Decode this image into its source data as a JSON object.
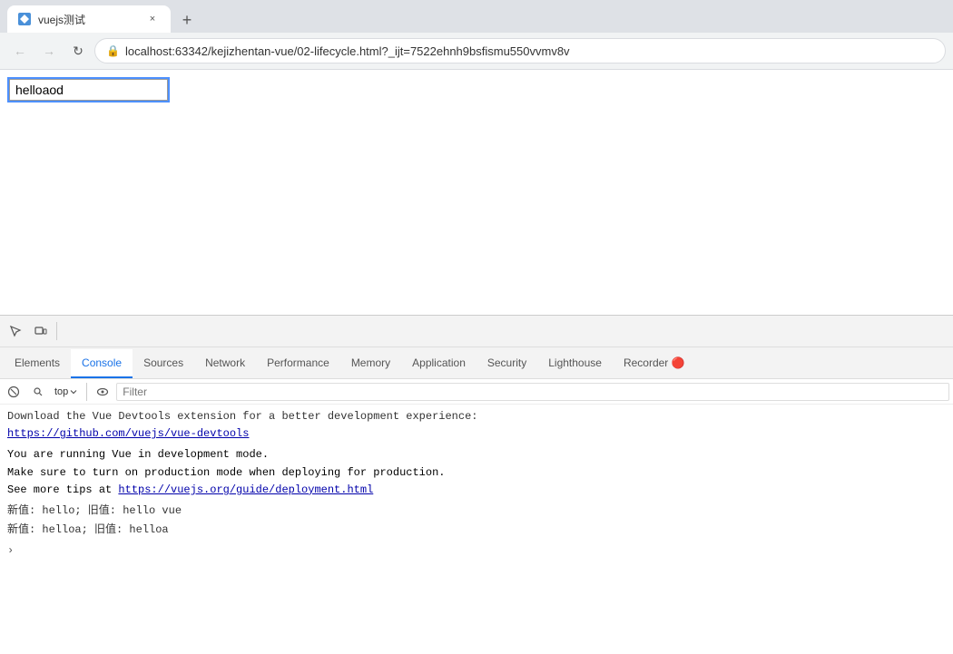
{
  "browser": {
    "tab": {
      "favicon_label": "vue",
      "title": "vuejs测试",
      "close_label": "×"
    },
    "new_tab_label": "+",
    "nav": {
      "back_label": "←",
      "forward_label": "→",
      "reload_label": "↻"
    },
    "address": {
      "lock_icon": "🔒",
      "url": "localhost:63342/kejizhentan-vue/02-lifecycle.html?_ijt=7522ehnh9bsfismu550vvmv8v"
    }
  },
  "page": {
    "input_value": "helloaod",
    "input_placeholder": ""
  },
  "devtools": {
    "tabs": [
      {
        "id": "elements",
        "label": "Elements",
        "active": false
      },
      {
        "id": "console",
        "label": "Console",
        "active": true
      },
      {
        "id": "sources",
        "label": "Sources",
        "active": false
      },
      {
        "id": "network",
        "label": "Network",
        "active": false
      },
      {
        "id": "performance",
        "label": "Performance",
        "active": false
      },
      {
        "id": "memory",
        "label": "Memory",
        "active": false
      },
      {
        "id": "application",
        "label": "Application",
        "active": false
      },
      {
        "id": "security",
        "label": "Security",
        "active": false
      },
      {
        "id": "lighthouse",
        "label": "Lighthouse",
        "active": false
      },
      {
        "id": "recorder",
        "label": "Recorder 🔴",
        "active": false
      }
    ],
    "console": {
      "context": "top",
      "filter_placeholder": "Filter",
      "messages": [
        {
          "type": "info",
          "text": "Download the Vue Devtools extension for a better development experience:",
          "link": "https://github.com/vuejs/vue-devtools"
        },
        {
          "type": "warning",
          "lines": [
            "You are running Vue in development mode.",
            "Make sure to turn on production mode when deploying for production.",
            "See more tips at "
          ],
          "link": "https://vuejs.org/guide/deployment.html"
        },
        {
          "type": "log",
          "text": "新值: hello; 旧值: hello vue"
        },
        {
          "type": "log",
          "text": "新值: helloa; 旧值: helloa"
        }
      ]
    }
  }
}
